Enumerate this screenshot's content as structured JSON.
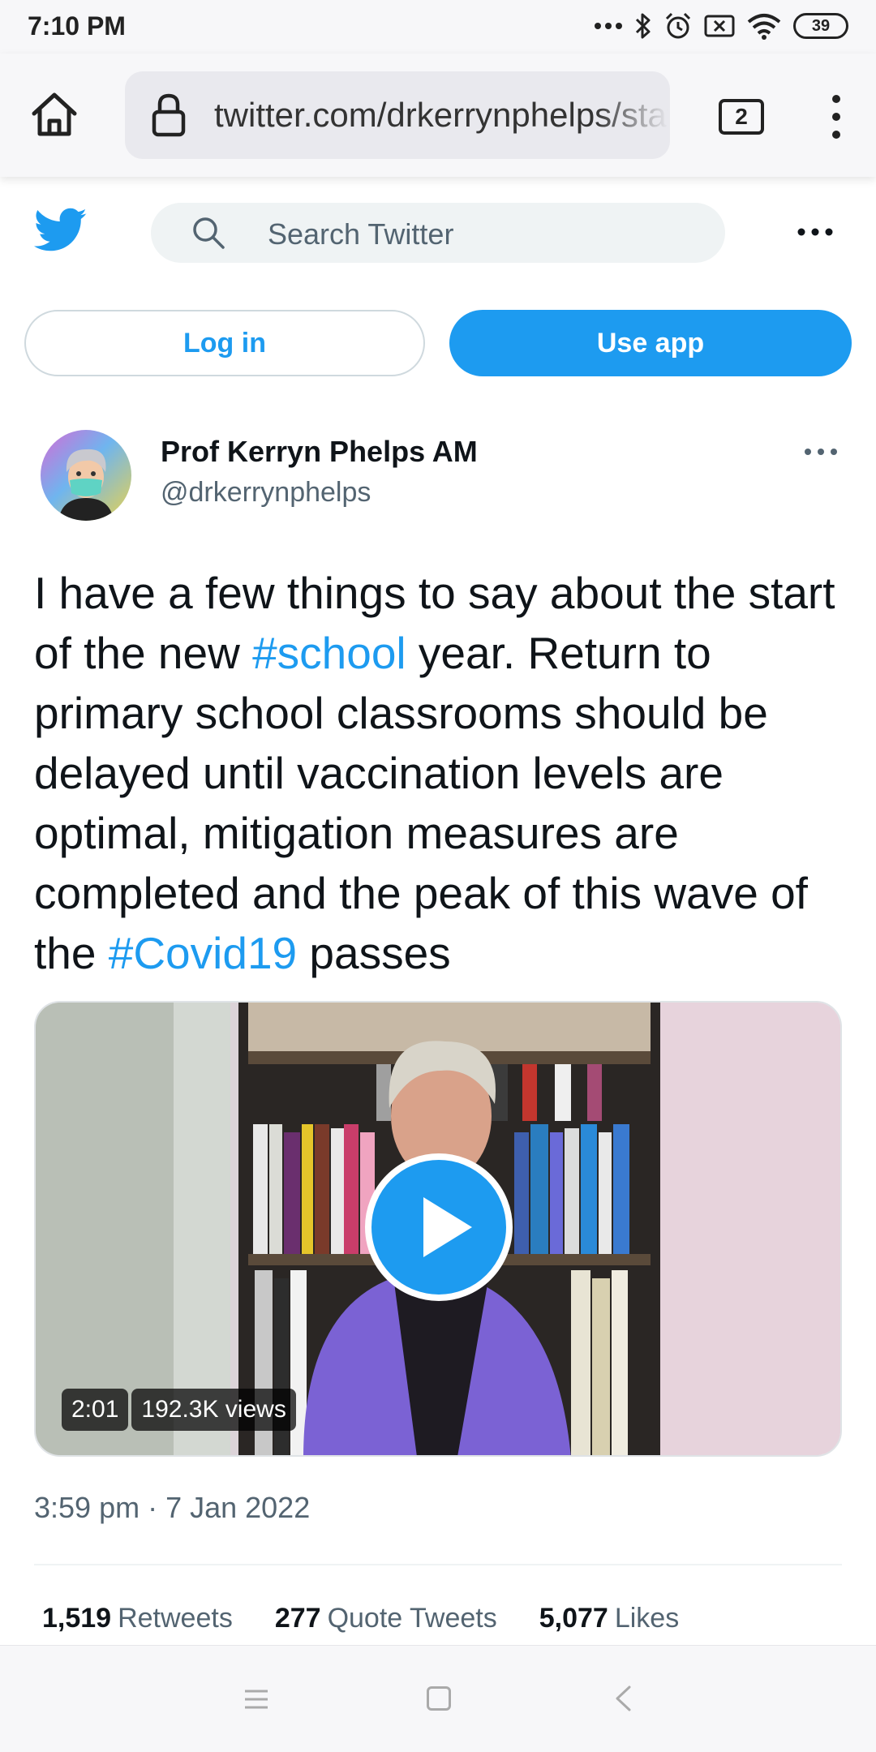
{
  "status_bar": {
    "time": "7:10 PM",
    "battery": "39",
    "icons": [
      "more-dots-icon",
      "bluetooth-icon",
      "alarm-icon",
      "no-sim-icon",
      "wifi-icon",
      "battery-icon"
    ]
  },
  "browser": {
    "url": "twitter.com/drkerrynphelps/status",
    "tab_count": "2",
    "icons": [
      "home-icon",
      "lock-icon",
      "tabs-icon",
      "overflow-menu-icon"
    ]
  },
  "header": {
    "search_placeholder": "Search Twitter",
    "icons": [
      "twitter-logo-icon",
      "search-icon",
      "more-icon"
    ]
  },
  "auth": {
    "login_label": "Log in",
    "use_app_label": "Use app"
  },
  "tweet": {
    "author_name": "Prof Kerryn Phelps AM",
    "author_handle": "@drkerrynphelps",
    "text_parts": {
      "p1": "I have a few things to say about the start of the new ",
      "tag1": "#school",
      "p2": " year. Return to primary school classrooms should be delayed until vaccination levels are optimal, mitigation measures are completed and the peak of this wave of the ",
      "tag2": "#Covid19",
      "p3": " passes"
    },
    "video": {
      "duration": "2:01",
      "views": "192.3K views"
    },
    "timestamp": "3:59 pm · 7 Jan 2022",
    "stats": {
      "retweets_count": "1,519",
      "retweets_label": "Retweets",
      "quotes_count": "277",
      "quotes_label": "Quote Tweets",
      "likes_count": "5,077",
      "likes_label": "Likes"
    }
  },
  "colors": {
    "twitter_blue": "#1d9bf0",
    "text_primary": "#0f1419",
    "text_secondary": "#536471",
    "jacket_purple": "#7b62d4"
  }
}
